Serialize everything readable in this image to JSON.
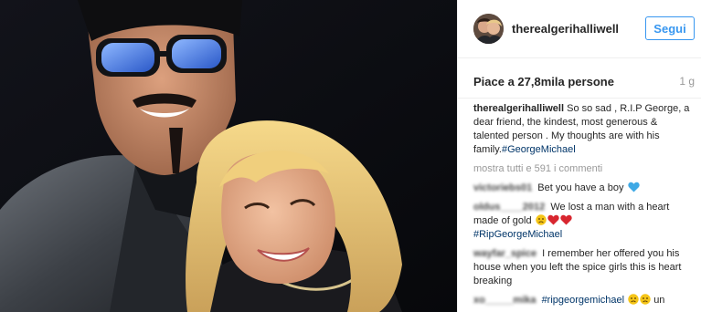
{
  "post": {
    "username": "therealgerihalliwell",
    "follow_label": "Segui",
    "likes_text": "Piace a 27,8mila persone",
    "time_ago": "1 g"
  },
  "caption": {
    "username": "therealgerihalliwell",
    "text": "So so sad , R.I.P George, a dear friend, the kindest, most generous & talented person . My thoughts are with his family.",
    "hashtag": "#GeorgeMichael"
  },
  "view_all_comments": "mostra tutti e 591 i commenti",
  "comments": [
    {
      "username": "victoriebs01",
      "text": "Bet you have a boy",
      "emojis": [
        "blue-heart-icon"
      ]
    },
    {
      "username": "oldus____2012",
      "text": "We lost a man with a heart made of gold",
      "emojis": [
        "sad-face-icon",
        "red-heart-icon",
        "red-heart-icon"
      ],
      "hashtag": "#RipGeorgeMichael"
    },
    {
      "username": "wayfar_spice",
      "text": "I remember her offered you his house when you left the spice girls this is heart breaking"
    },
    {
      "username": "xo_____mika",
      "hashtag": "#ripgeorgemichael",
      "emojis": [
        "sad-face-icon",
        "sad-face-icon"
      ],
      "text_after": "un"
    }
  ],
  "colors": {
    "link_blue": "#3897f0",
    "hashtag_blue": "#003569",
    "muted_gray": "#999999",
    "text_dark": "#262626"
  }
}
